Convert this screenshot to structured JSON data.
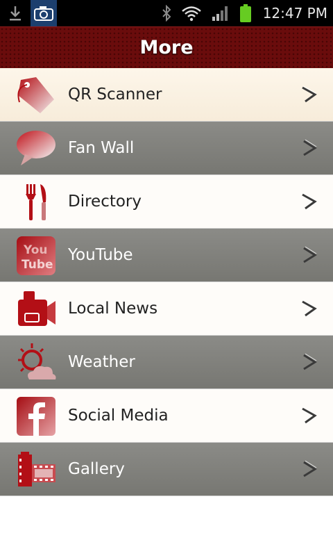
{
  "status_bar": {
    "time": "12:47 PM",
    "icons": [
      "download-icon",
      "camera-icon",
      "bluetooth-icon",
      "wifi-icon",
      "signal-icon",
      "battery-icon"
    ]
  },
  "header": {
    "title": "More"
  },
  "menu": {
    "items": [
      {
        "label": "QR Scanner",
        "icon": "tag-icon"
      },
      {
        "label": "Fan Wall",
        "icon": "speech-bubble-icon"
      },
      {
        "label": "Directory",
        "icon": "fork-knife-icon"
      },
      {
        "label": "YouTube",
        "icon": "youtube-icon"
      },
      {
        "label": "Local News",
        "icon": "video-camera-icon"
      },
      {
        "label": "Weather",
        "icon": "weather-icon"
      },
      {
        "label": "Social Media",
        "icon": "facebook-icon"
      },
      {
        "label": "Gallery",
        "icon": "film-icon"
      }
    ]
  },
  "colors": {
    "brand_red": "#7a0c0c",
    "row_gray": "#808080",
    "row_light": "#fbf3e6"
  }
}
